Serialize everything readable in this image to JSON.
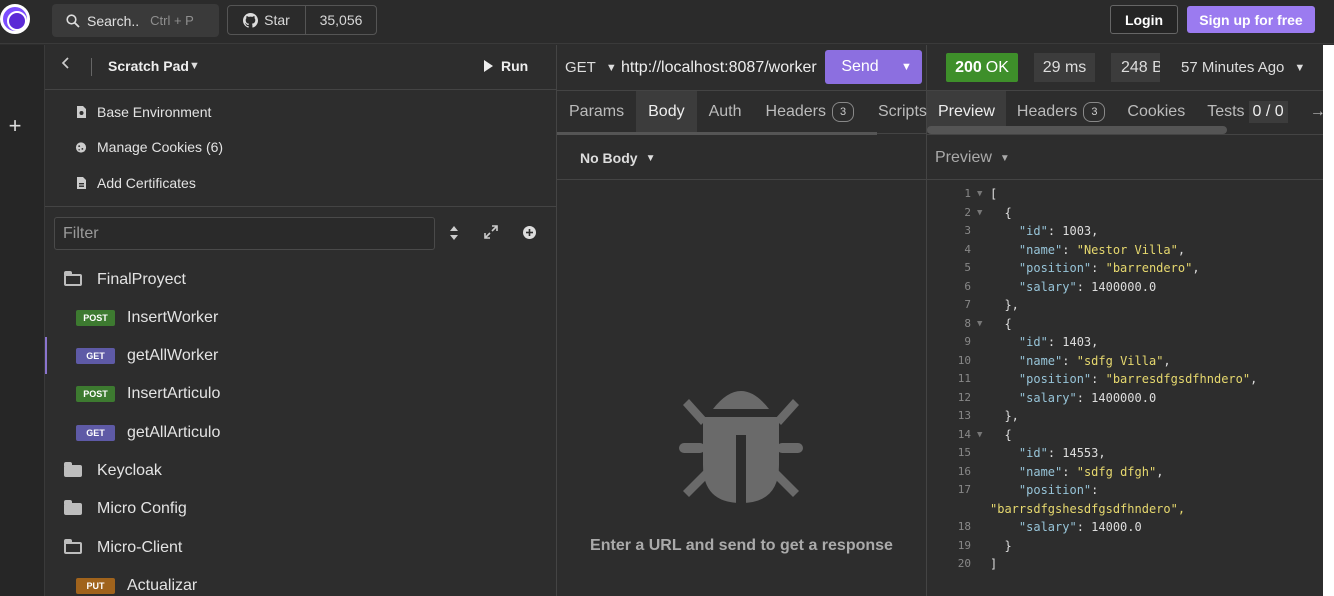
{
  "topbar": {
    "search_label": "Search..",
    "search_shortcut": "Ctrl + P",
    "star_label": "Star",
    "star_count": "35,056",
    "login_label": "Login",
    "signup_label": "Sign up for free"
  },
  "rail": {
    "add_label": "+"
  },
  "sidebar": {
    "title": "Scratch Pad",
    "run_label": "Run",
    "links": [
      {
        "label": "Base Environment"
      },
      {
        "label": "Manage Cookies (6)"
      },
      {
        "label": "Add Certificates"
      }
    ],
    "filter_placeholder": "Filter",
    "tree": [
      {
        "type": "folder",
        "state": "open",
        "label": "FinalProyect"
      },
      {
        "type": "request",
        "method": "POST",
        "label": "InsertWorker"
      },
      {
        "type": "request",
        "method": "GET",
        "label": "getAllWorker",
        "active": true
      },
      {
        "type": "request",
        "method": "POST",
        "label": "InsertArticulo"
      },
      {
        "type": "request",
        "method": "GET",
        "label": "getAllArticulo"
      },
      {
        "type": "folder",
        "state": "closed",
        "label": "Keycloak"
      },
      {
        "type": "folder",
        "state": "closed",
        "label": "Micro Config"
      },
      {
        "type": "folder",
        "state": "open",
        "label": "Micro-Client"
      },
      {
        "type": "request",
        "method": "PUT",
        "label": "Actualizar"
      }
    ]
  },
  "request": {
    "method": "GET",
    "url": "http://localhost:8087/worker",
    "send_label": "Send",
    "tabs": [
      {
        "label": "Params"
      },
      {
        "label": "Body",
        "active": true
      },
      {
        "label": "Auth"
      },
      {
        "label": "Headers",
        "count": "3"
      },
      {
        "label": "Scripts"
      }
    ],
    "body_mode": "No Body",
    "empty_message": "Enter a URL and send to get a response"
  },
  "response": {
    "status_code": "200",
    "status_text": "OK",
    "time": "29 ms",
    "size": "248 B",
    "ago": "57 Minutes Ago",
    "tabs": [
      {
        "label": "Preview",
        "active": true
      },
      {
        "label": "Headers",
        "count": "3"
      },
      {
        "label": "Cookies"
      },
      {
        "label": "Tests",
        "count": "0 / 0"
      },
      {
        "label": "→"
      }
    ],
    "preview_mode": "Preview",
    "lines": [
      {
        "n": "1",
        "fold": true,
        "text": "["
      },
      {
        "n": "2",
        "fold": true,
        "text": "  {"
      },
      {
        "n": "3",
        "text": "    \"id\": 1003,"
      },
      {
        "n": "4",
        "text": "    \"name\": \"Nestor Villa\","
      },
      {
        "n": "5",
        "text": "    \"position\": \"barrendero\","
      },
      {
        "n": "6",
        "text": "    \"salary\": 1400000.0"
      },
      {
        "n": "7",
        "text": "  },"
      },
      {
        "n": "8",
        "fold": true,
        "text": "  {"
      },
      {
        "n": "9",
        "text": "    \"id\": 1403,"
      },
      {
        "n": "10",
        "text": "    \"name\": \"sdfg Villa\","
      },
      {
        "n": "11",
        "text": "    \"position\": \"barresdfgsdfhndero\","
      },
      {
        "n": "12",
        "text": "    \"salary\": 1400000.0"
      },
      {
        "n": "13",
        "text": "  },"
      },
      {
        "n": "14",
        "fold": true,
        "text": "  {"
      },
      {
        "n": "15",
        "text": "    \"id\": 14553,"
      },
      {
        "n": "16",
        "text": "    \"name\": \"sdfg dfgh\","
      },
      {
        "n": "17",
        "text": "    \"position\":"
      },
      {
        "n": "",
        "text": "\"barrsdfgshesdfgsdfhndero\","
      },
      {
        "n": "18",
        "text": "    \"salary\": 14000.0"
      },
      {
        "n": "19",
        "text": "  }"
      },
      {
        "n": "20",
        "text": "]"
      }
    ]
  },
  "colors": {
    "accent": "#8c6fe0",
    "status_ok": "#3e8f2a",
    "json_key": "#97c4d8",
    "json_string": "#e6d86e"
  }
}
